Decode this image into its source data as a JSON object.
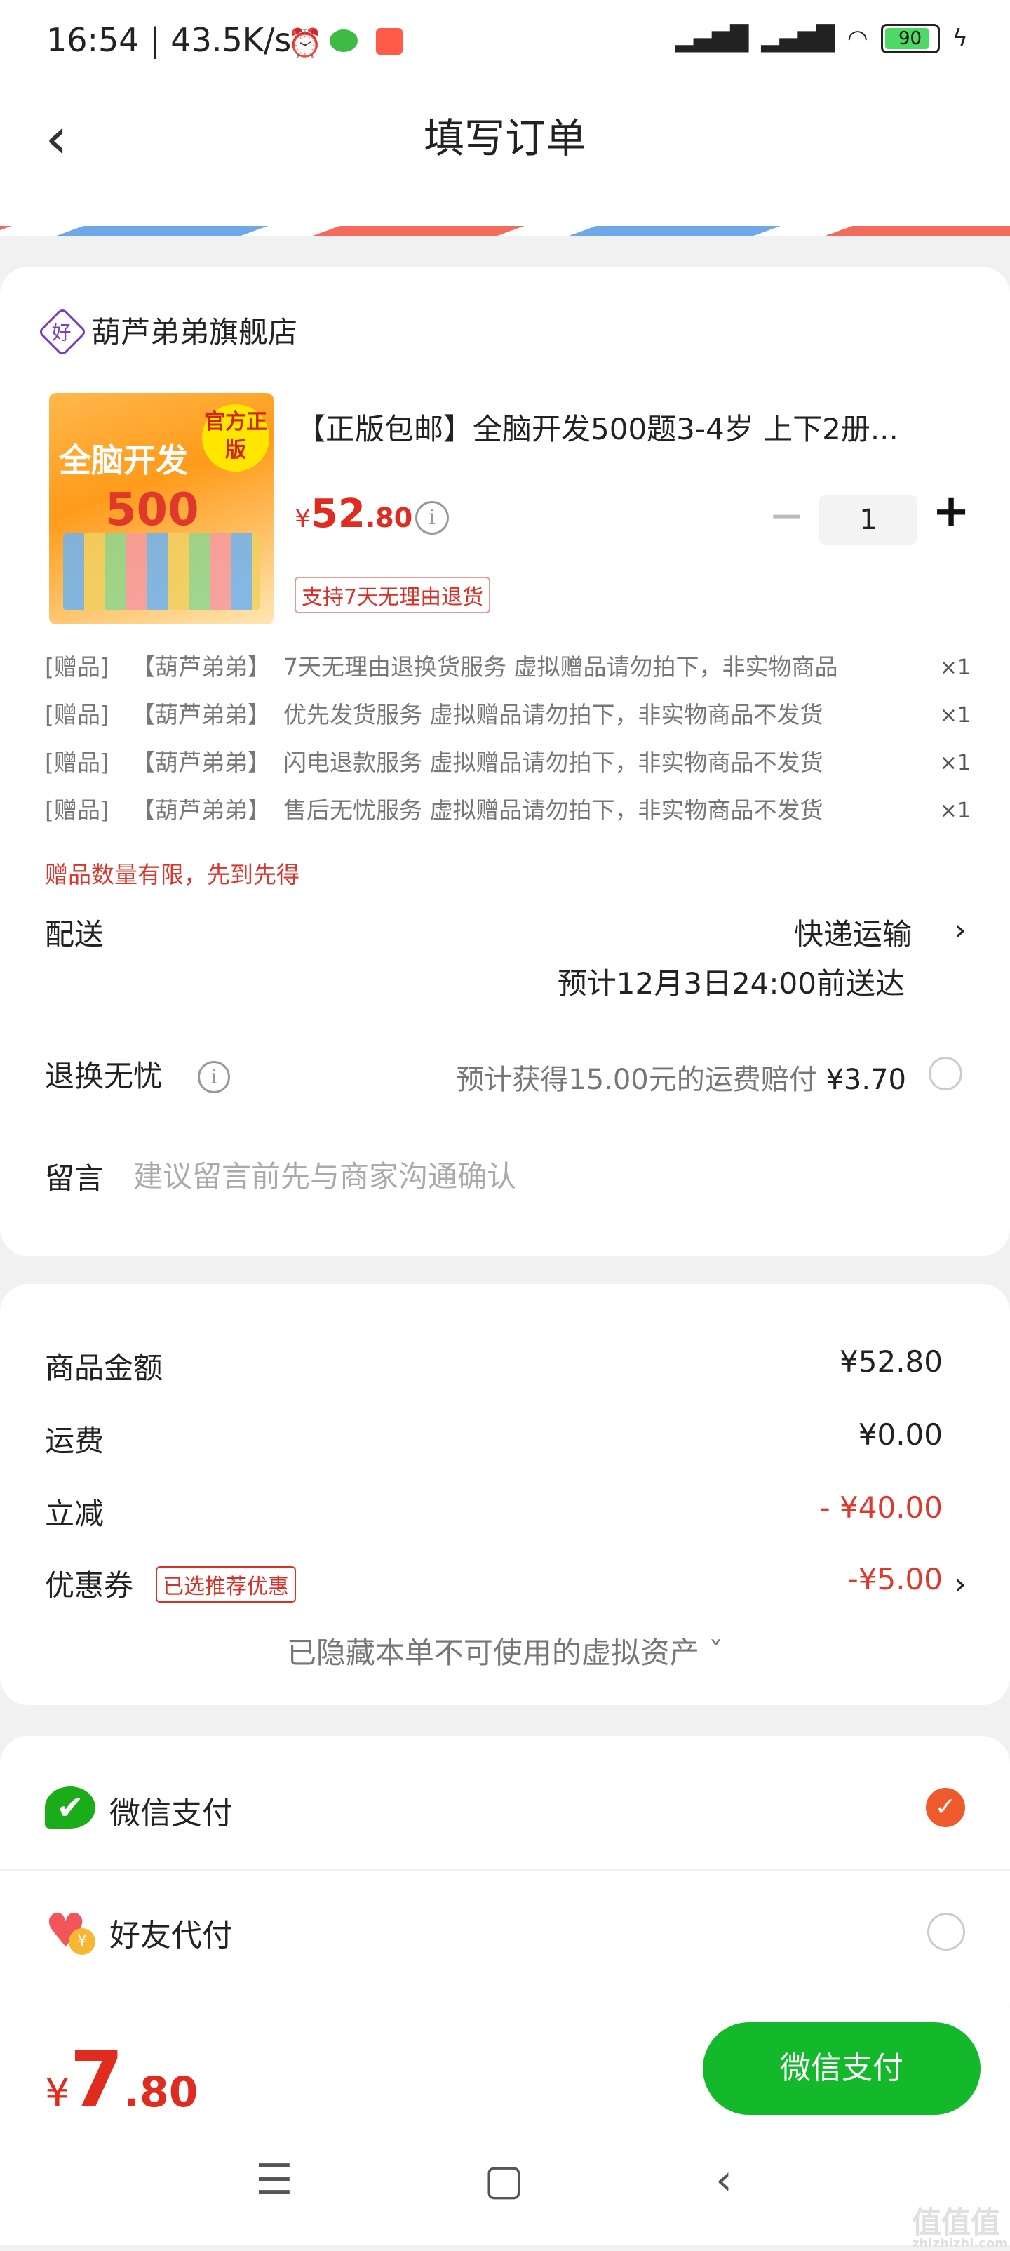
{
  "status_bar": {
    "time": "16:54 | 43.5K/s",
    "battery": "90",
    "icons": [
      "alarm-icon",
      "wechat-icon",
      "app-icon",
      "signal-icon",
      "wifi-icon",
      "battery-icon",
      "charging-icon"
    ]
  },
  "nav": {
    "title": "填写订单",
    "back_icon": "chevron-left-icon"
  },
  "shop": {
    "name": "葫芦弟弟旗舰店",
    "icon_text": "好"
  },
  "product": {
    "thumb_text": {
      "title": "全脑开发",
      "number": "500",
      "badge": "官方正版"
    },
    "title": "【正版包邮】全脑开发500题3-4岁 上下2册...",
    "price": {
      "currency": "¥",
      "int": "52",
      "dec": ".80"
    },
    "quantity": "1",
    "minus": "−",
    "plus": "+",
    "return_policy": "支持7天无理由退货"
  },
  "gifts": [
    {
      "tag": "[赠品]",
      "brand": "【葫芦弟弟】",
      "desc": "7天无理由退换货服务 虚拟赠品请勿拍下，非实物商品",
      "qty": "×1"
    },
    {
      "tag": "[赠品]",
      "brand": "【葫芦弟弟】",
      "desc": "优先发货服务 虚拟赠品请勿拍下，非实物商品不发货",
      "qty": "×1"
    },
    {
      "tag": "[赠品]",
      "brand": "【葫芦弟弟】",
      "desc": "闪电退款服务 虚拟赠品请勿拍下，非实物商品不发货",
      "qty": "×1"
    },
    {
      "tag": "[赠品]",
      "brand": "【葫芦弟弟】",
      "desc": "售后无忧服务 虚拟赠品请勿拍下，非实物商品不发货",
      "qty": "×1"
    }
  ],
  "gift_notice": "赠品数量有限，先到先得",
  "shipping": {
    "label": "配送",
    "method": "快递运输",
    "arrow": "›",
    "eta": "预计12月3日24:00前送达"
  },
  "return_worry": {
    "label": "退换无忧",
    "desc": "预计获得15.00元的运费赔付",
    "price": "¥3.70"
  },
  "message": {
    "label": "留言",
    "placeholder": "建议留言前先与商家沟通确认"
  },
  "summary": {
    "goods_label": "商品金额",
    "goods_value": "¥52.80",
    "freight_label": "运费",
    "freight_value": "¥0.00",
    "discount_label": "立减",
    "discount_value": "- ¥40.00",
    "coupon_label": "优惠券",
    "coupon_tag": "已选推荐优惠",
    "coupon_value": "-¥5.00",
    "coupon_arrow": "›",
    "hidden_assets": "已隐藏本单不可使用的虚拟资产 ˇ"
  },
  "payment": {
    "wechat_label": "微信支付",
    "friend_label": "好友代付",
    "friend_coin": "¥"
  },
  "bottom": {
    "total": {
      "currency": "¥",
      "int": "7",
      "dec": ".80"
    },
    "pay_button": "微信支付"
  },
  "system_nav": {
    "menu": "☰",
    "home": "▢",
    "back": "‹"
  },
  "watermark": {
    "text": "值值值",
    "sub": "zhizhizhi.com"
  },
  "colors": {
    "price_red": "#e02b1f",
    "wechat_green": "#13b92b",
    "check_orange": "#ef5a2c"
  }
}
